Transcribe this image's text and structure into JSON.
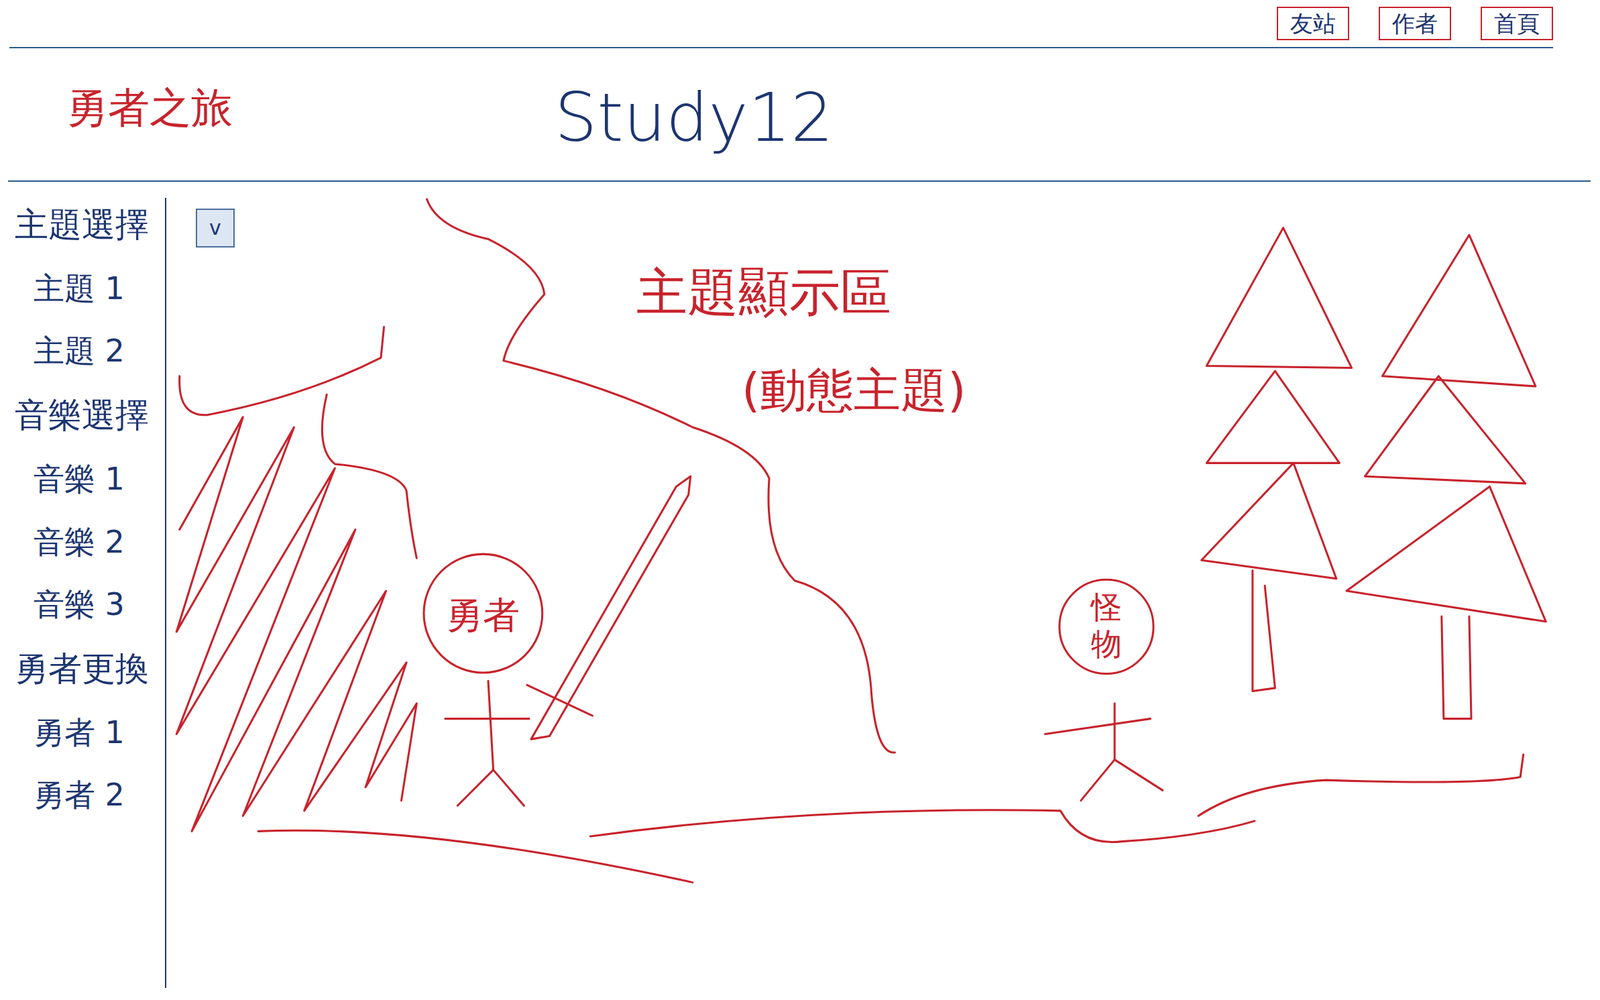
{
  "site_title": "勇者之旅",
  "header_title": "Study12",
  "nav_links": [
    "友站",
    "作者",
    "首頁"
  ],
  "sidebar": {
    "sections": [
      {
        "heading": "主題選擇",
        "items": [
          "主題 1",
          "主題 2"
        ]
      },
      {
        "heading": "音樂選擇",
        "items": [
          "音樂 1",
          "音樂 2",
          "音樂 3"
        ]
      },
      {
        "heading": "勇者更換",
        "items": [
          "勇者 1",
          "勇者 2"
        ]
      }
    ]
  },
  "dropdown": {
    "label": "v"
  },
  "scene": {
    "title": "主題顯示區",
    "subtitle": "(動態主題)",
    "hero": "勇者",
    "monster": "怪物"
  }
}
